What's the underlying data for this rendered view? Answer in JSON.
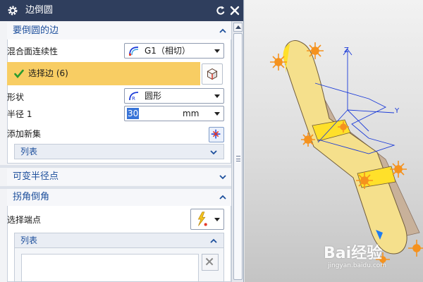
{
  "dialog": {
    "title": "边倒圆",
    "icons": {
      "settings": "gear-icon",
      "reset": "reset-icon",
      "close": "close-icon"
    }
  },
  "group_edges": {
    "header": "要倒圆的边",
    "continuity_label": "混合面连续性",
    "continuity_value": "G1（相切）",
    "select_edge_label": "选择边 (6)",
    "shape_label": "形状",
    "shape_value": "圆形",
    "radius_label": "半径 1",
    "radius_value": "30",
    "radius_unit": "mm",
    "add_new_set_label": "添加新集",
    "list_label": "列表"
  },
  "group_variable": {
    "header": "可变半径点"
  },
  "group_corner": {
    "header": "拐角倒角",
    "select_endpoint_label": "选择端点",
    "list_label": "列表"
  },
  "viewport": {
    "axis_labels": {
      "z": "Z",
      "y": "Y"
    },
    "watermark": "Bai经验",
    "watermark_url": "jingyan.baidu.com"
  },
  "colors": {
    "title_bar": "#2f3e5d",
    "group_header_text": "#1d4f9c",
    "selection_highlight": "#f8cd63",
    "part_face": "#f5e08c",
    "part_side": "#c8b19a",
    "selected_face": "#ffe02a",
    "edge_marker": "#f5921e",
    "axis_blue": "#1a3ad8"
  }
}
